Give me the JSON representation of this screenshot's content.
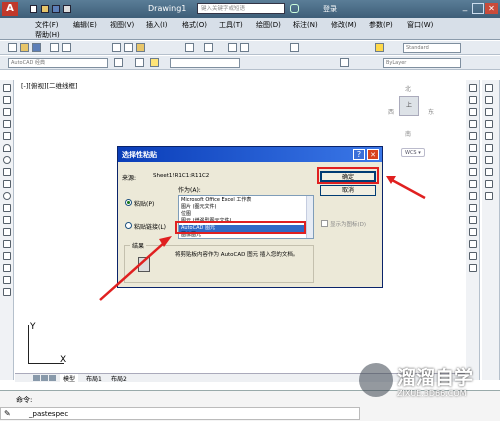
{
  "title": {
    "app_name": "Drawing1",
    "search_placeholder": "键入关键字或短语",
    "login": "登录",
    "extra": "帮助(H)"
  },
  "menu": [
    "文件(F)",
    "编辑(E)",
    "视图(V)",
    "插入(I)",
    "格式(O)",
    "工具(T)",
    "绘图(D)",
    "标注(N)",
    "修改(M)",
    "参数(P)",
    "窗口(W)"
  ],
  "toolbar": {
    "workspace": "AutoCAD 经典",
    "text_style": "Standard",
    "layer_combo": "ByLayer"
  },
  "viewport": {
    "label": "[-][俯视][二维线框]",
    "compass": {
      "north": "北",
      "south": "南",
      "east": "东",
      "west": "西",
      "top": "上"
    },
    "wcs": "WCS ▾"
  },
  "dialog": {
    "title": "选择性粘贴",
    "help": "?",
    "close": "✕",
    "source_label": "来源:",
    "source_value": "Sheet1!R1C1:R11C2",
    "as_label": "作为(A):",
    "ok_label": "确定",
    "cancel_label": "取消",
    "paste_label": "粘贴(P)",
    "paste_link_label": "粘贴链接(L)",
    "display_as_icon_label": "显示为图标(D)",
    "result_label": "结果",
    "result_text": "将剪贴板内容作为 AutoCAD 图元 插入您的文档。",
    "list": [
      "Microsoft Office Excel 工作表",
      "图片 (图元文件)",
      "位图",
      "图元 (增强型图元文件)",
      "AutoCAD 图元",
      "图像图元"
    ],
    "selected_index": 4
  },
  "tabs": {
    "model": "模型",
    "layout1": "布局1",
    "layout2": "布局2"
  },
  "command": {
    "prompt": "命令:",
    "history": "_pastespec"
  },
  "watermark": {
    "name": "溜溜自学",
    "url": "ZIXUE.3D66.COM"
  },
  "colors": {
    "accent": "#e02020",
    "title": "#0a3db8"
  }
}
